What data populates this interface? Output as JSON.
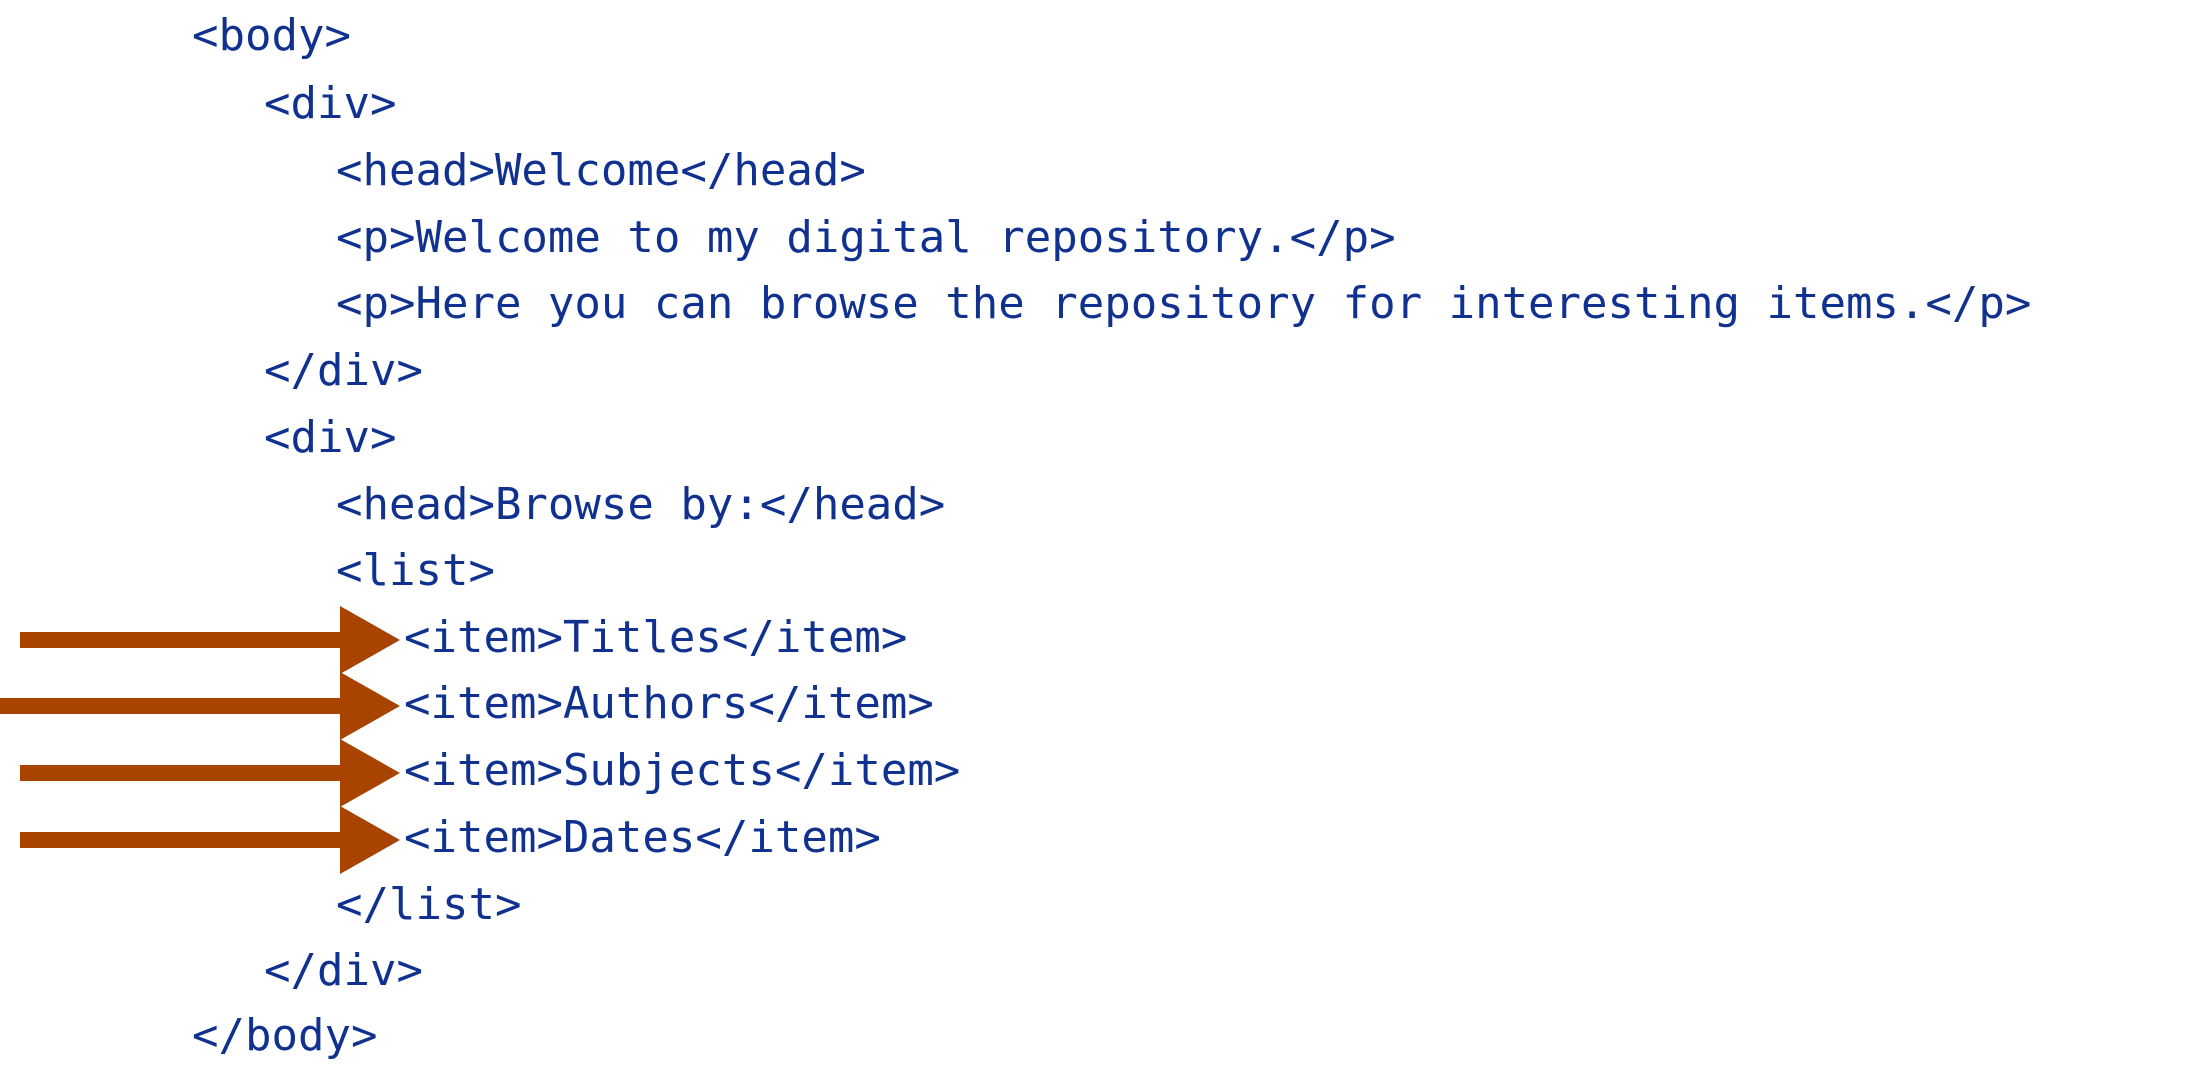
{
  "code_lines": [
    "<body>",
    "<div>",
    "<head>Welcome</head>",
    "<p>Welcome to my digital repository.</p>",
    "<p>Here you can browse the repository for interesting items.</p>",
    "</div>",
    "<div>",
    "<head>Browse by:</head>",
    "<list>",
    "<item>Titles</item>",
    "<item>Authors</item>",
    "<item>Subjects</item>",
    "<item>Dates</item>",
    "</list>",
    "</div>",
    "</body>"
  ],
  "arrow_color": "#a84300",
  "text_color": "#10318f",
  "highlighted_lines": [
    9,
    10,
    11,
    12
  ]
}
